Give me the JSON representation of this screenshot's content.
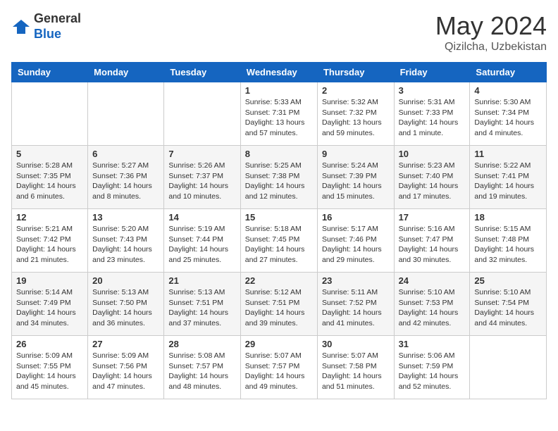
{
  "header": {
    "logo_general": "General",
    "logo_blue": "Blue",
    "month_year": "May 2024",
    "location": "Qizilcha, Uzbekistan"
  },
  "weekdays": [
    "Sunday",
    "Monday",
    "Tuesday",
    "Wednesday",
    "Thursday",
    "Friday",
    "Saturday"
  ],
  "weeks": [
    [
      {
        "day": "",
        "sunrise": "",
        "sunset": "",
        "daylight": ""
      },
      {
        "day": "",
        "sunrise": "",
        "sunset": "",
        "daylight": ""
      },
      {
        "day": "",
        "sunrise": "",
        "sunset": "",
        "daylight": ""
      },
      {
        "day": "1",
        "sunrise": "Sunrise: 5:33 AM",
        "sunset": "Sunset: 7:31 PM",
        "daylight": "Daylight: 13 hours and 57 minutes."
      },
      {
        "day": "2",
        "sunrise": "Sunrise: 5:32 AM",
        "sunset": "Sunset: 7:32 PM",
        "daylight": "Daylight: 13 hours and 59 minutes."
      },
      {
        "day": "3",
        "sunrise": "Sunrise: 5:31 AM",
        "sunset": "Sunset: 7:33 PM",
        "daylight": "Daylight: 14 hours and 1 minute."
      },
      {
        "day": "4",
        "sunrise": "Sunrise: 5:30 AM",
        "sunset": "Sunset: 7:34 PM",
        "daylight": "Daylight: 14 hours and 4 minutes."
      }
    ],
    [
      {
        "day": "5",
        "sunrise": "Sunrise: 5:28 AM",
        "sunset": "Sunset: 7:35 PM",
        "daylight": "Daylight: 14 hours and 6 minutes."
      },
      {
        "day": "6",
        "sunrise": "Sunrise: 5:27 AM",
        "sunset": "Sunset: 7:36 PM",
        "daylight": "Daylight: 14 hours and 8 minutes."
      },
      {
        "day": "7",
        "sunrise": "Sunrise: 5:26 AM",
        "sunset": "Sunset: 7:37 PM",
        "daylight": "Daylight: 14 hours and 10 minutes."
      },
      {
        "day": "8",
        "sunrise": "Sunrise: 5:25 AM",
        "sunset": "Sunset: 7:38 PM",
        "daylight": "Daylight: 14 hours and 12 minutes."
      },
      {
        "day": "9",
        "sunrise": "Sunrise: 5:24 AM",
        "sunset": "Sunset: 7:39 PM",
        "daylight": "Daylight: 14 hours and 15 minutes."
      },
      {
        "day": "10",
        "sunrise": "Sunrise: 5:23 AM",
        "sunset": "Sunset: 7:40 PM",
        "daylight": "Daylight: 14 hours and 17 minutes."
      },
      {
        "day": "11",
        "sunrise": "Sunrise: 5:22 AM",
        "sunset": "Sunset: 7:41 PM",
        "daylight": "Daylight: 14 hours and 19 minutes."
      }
    ],
    [
      {
        "day": "12",
        "sunrise": "Sunrise: 5:21 AM",
        "sunset": "Sunset: 7:42 PM",
        "daylight": "Daylight: 14 hours and 21 minutes."
      },
      {
        "day": "13",
        "sunrise": "Sunrise: 5:20 AM",
        "sunset": "Sunset: 7:43 PM",
        "daylight": "Daylight: 14 hours and 23 minutes."
      },
      {
        "day": "14",
        "sunrise": "Sunrise: 5:19 AM",
        "sunset": "Sunset: 7:44 PM",
        "daylight": "Daylight: 14 hours and 25 minutes."
      },
      {
        "day": "15",
        "sunrise": "Sunrise: 5:18 AM",
        "sunset": "Sunset: 7:45 PM",
        "daylight": "Daylight: 14 hours and 27 minutes."
      },
      {
        "day": "16",
        "sunrise": "Sunrise: 5:17 AM",
        "sunset": "Sunset: 7:46 PM",
        "daylight": "Daylight: 14 hours and 29 minutes."
      },
      {
        "day": "17",
        "sunrise": "Sunrise: 5:16 AM",
        "sunset": "Sunset: 7:47 PM",
        "daylight": "Daylight: 14 hours and 30 minutes."
      },
      {
        "day": "18",
        "sunrise": "Sunrise: 5:15 AM",
        "sunset": "Sunset: 7:48 PM",
        "daylight": "Daylight: 14 hours and 32 minutes."
      }
    ],
    [
      {
        "day": "19",
        "sunrise": "Sunrise: 5:14 AM",
        "sunset": "Sunset: 7:49 PM",
        "daylight": "Daylight: 14 hours and 34 minutes."
      },
      {
        "day": "20",
        "sunrise": "Sunrise: 5:13 AM",
        "sunset": "Sunset: 7:50 PM",
        "daylight": "Daylight: 14 hours and 36 minutes."
      },
      {
        "day": "21",
        "sunrise": "Sunrise: 5:13 AM",
        "sunset": "Sunset: 7:51 PM",
        "daylight": "Daylight: 14 hours and 37 minutes."
      },
      {
        "day": "22",
        "sunrise": "Sunrise: 5:12 AM",
        "sunset": "Sunset: 7:51 PM",
        "daylight": "Daylight: 14 hours and 39 minutes."
      },
      {
        "day": "23",
        "sunrise": "Sunrise: 5:11 AM",
        "sunset": "Sunset: 7:52 PM",
        "daylight": "Daylight: 14 hours and 41 minutes."
      },
      {
        "day": "24",
        "sunrise": "Sunrise: 5:10 AM",
        "sunset": "Sunset: 7:53 PM",
        "daylight": "Daylight: 14 hours and 42 minutes."
      },
      {
        "day": "25",
        "sunrise": "Sunrise: 5:10 AM",
        "sunset": "Sunset: 7:54 PM",
        "daylight": "Daylight: 14 hours and 44 minutes."
      }
    ],
    [
      {
        "day": "26",
        "sunrise": "Sunrise: 5:09 AM",
        "sunset": "Sunset: 7:55 PM",
        "daylight": "Daylight: 14 hours and 45 minutes."
      },
      {
        "day": "27",
        "sunrise": "Sunrise: 5:09 AM",
        "sunset": "Sunset: 7:56 PM",
        "daylight": "Daylight: 14 hours and 47 minutes."
      },
      {
        "day": "28",
        "sunrise": "Sunrise: 5:08 AM",
        "sunset": "Sunset: 7:57 PM",
        "daylight": "Daylight: 14 hours and 48 minutes."
      },
      {
        "day": "29",
        "sunrise": "Sunrise: 5:07 AM",
        "sunset": "Sunset: 7:57 PM",
        "daylight": "Daylight: 14 hours and 49 minutes."
      },
      {
        "day": "30",
        "sunrise": "Sunrise: 5:07 AM",
        "sunset": "Sunset: 7:58 PM",
        "daylight": "Daylight: 14 hours and 51 minutes."
      },
      {
        "day": "31",
        "sunrise": "Sunrise: 5:06 AM",
        "sunset": "Sunset: 7:59 PM",
        "daylight": "Daylight: 14 hours and 52 minutes."
      },
      {
        "day": "",
        "sunrise": "",
        "sunset": "",
        "daylight": ""
      }
    ]
  ]
}
